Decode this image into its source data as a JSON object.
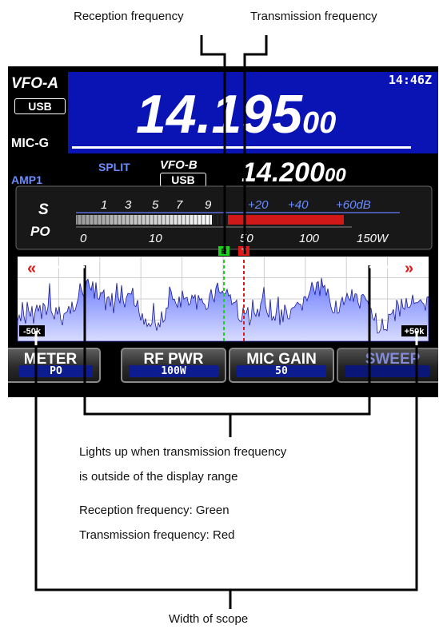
{
  "callouts": {
    "rx_freq": "Reception frequency",
    "tx_freq": "Transmission frequency",
    "lights_line1": "Lights up when transmission frequency",
    "lights_line2": "is outside of the display range",
    "rx_color": "Reception frequency: Green",
    "tx_color": "Transmission frequency: Red",
    "scope_width": "Width of scope"
  },
  "display": {
    "time": "14:46Z",
    "vfo_a": "VFO-A",
    "mode_a": "USB",
    "mic_g": "MIC-G",
    "freq_a_main": "14.195",
    "freq_a_small": "00",
    "split": "SPLIT",
    "vfo_b": "VFO-B",
    "mode_b": "USB",
    "amp": "AMP1",
    "freq_b_main": "14.200",
    "freq_b_small": "00"
  },
  "meter": {
    "s_label": "S",
    "po_label": "PO",
    "s_ticks": [
      "1",
      "3",
      "5",
      "7",
      "9",
      "+20",
      "+40",
      "+60dB"
    ],
    "po_ticks": [
      "0",
      "10",
      "50",
      "100",
      "150W"
    ],
    "rx_marker": "R",
    "tx_marker": "T",
    "s_level_fraction": 0.55,
    "po_level_fraction": 1.0
  },
  "scope": {
    "left_span": "-50k",
    "right_span": "+50k",
    "left_arrow": "«",
    "right_arrow": "»"
  },
  "softkeys": [
    {
      "label": "METER",
      "value": "PO"
    },
    {
      "label": "RF PWR",
      "value": "100W"
    },
    {
      "label": "MIC GAIN",
      "value": "50"
    },
    {
      "label": "SWEEP",
      "value": ""
    }
  ],
  "colors": {
    "rx": "#19d219",
    "tx": "#e01818",
    "freq_band": "#0a14b4",
    "spectrum": "#5060e0"
  }
}
